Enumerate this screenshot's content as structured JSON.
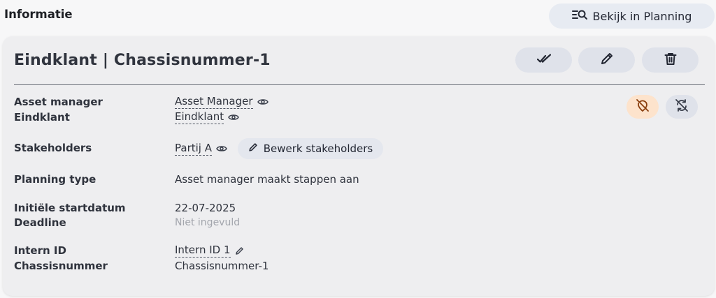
{
  "section": {
    "title": "Informatie"
  },
  "planning_button": {
    "label": "Bekijk in Planning",
    "icon": "list-search-icon"
  },
  "card": {
    "title": "Eindklant | Chassisnummer-1",
    "actions": [
      {
        "name": "approve",
        "icon": "double-check-icon"
      },
      {
        "name": "edit",
        "icon": "pencil-icon"
      },
      {
        "name": "delete",
        "icon": "trash-icon"
      }
    ],
    "side_buttons": [
      {
        "name": "hide-location",
        "icon": "location-off-icon",
        "background": "#fde3cc",
        "color": "#8a3f0f"
      },
      {
        "name": "sync-off",
        "icon": "sync-off-icon",
        "background": "#dfe2ea",
        "color": "#3a3f4b"
      }
    ]
  },
  "fields": {
    "asset_manager": {
      "label": "Asset manager",
      "value": "Asset Manager"
    },
    "eindklant": {
      "label": "Eindklant",
      "value": "Eindklant"
    },
    "stakeholders": {
      "label": "Stakeholders",
      "value": "Partij A",
      "button_label": "Bewerk stakeholders"
    },
    "planning_type": {
      "label": "Planning type",
      "value": "Asset manager maakt stappen aan"
    },
    "startdatum": {
      "label": "Initiële startdatum",
      "value": "22-07-2025"
    },
    "deadline": {
      "label": "Deadline",
      "value": "Niet ingevuld"
    },
    "intern_id": {
      "label": "Intern ID",
      "value": "Intern ID 1"
    },
    "chassisnummer": {
      "label": "Chassisnummer",
      "value": "Chassisnummer-1"
    }
  },
  "colors": {
    "page_background": "#f7f7f8",
    "card_background": "#eeeef0",
    "button_background": "#dfe2ea",
    "text": "#2f333d",
    "muted_text": "#a3a6ad"
  }
}
